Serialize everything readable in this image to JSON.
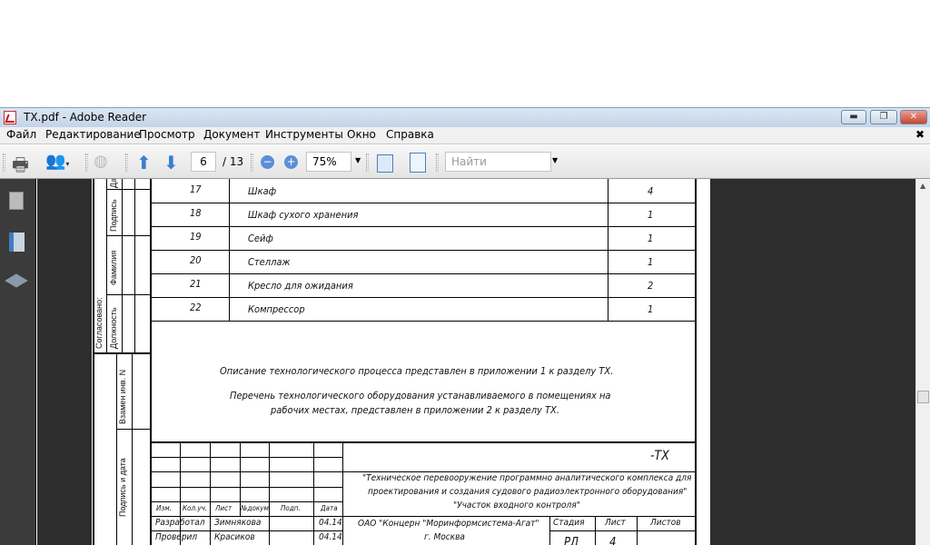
{
  "window": {
    "title": "TX.pdf - Adobe Reader"
  },
  "menu": [
    "Файл",
    "Редактирование",
    "Просмотр",
    "Документ",
    "Инструменты",
    "Окно",
    "Справка"
  ],
  "toolbar": {
    "page_current": "6",
    "page_total": "/ 13",
    "zoom": "75%",
    "search_placeholder": "Найти"
  },
  "stamps": {
    "date": "Дата",
    "signature": "Подпись",
    "surname": "Фамилия",
    "position": "Должность",
    "agreed": "Согласовано:",
    "replaced": "Взамен инв. N",
    "sign_date": "Подпись и дата"
  },
  "rows": [
    {
      "n": "17",
      "name": "Шкаф",
      "qty": "4"
    },
    {
      "n": "18",
      "name": "Шкаф сухого хранения",
      "qty": "1"
    },
    {
      "n": "19",
      "name": "Сейф",
      "qty": "1"
    },
    {
      "n": "20",
      "name": "Стеллаж",
      "qty": "1"
    },
    {
      "n": "21",
      "name": "Кресло для ожидания",
      "qty": "2"
    },
    {
      "n": "22",
      "name": "Компрессор",
      "qty": "1"
    }
  ],
  "notes": [
    "Описание технологического процесса представлен в приложении 1 к разделу ТХ.",
    "Перечень технологического оборудования устанавливаемого в помещениях на",
    "рабочих местах, представлен в приложении 2 к разделу ТХ."
  ],
  "titleblock": {
    "code": "-ТХ",
    "project_1": "\"Техническое перевооружение программно аналитического комплекса для",
    "project_2": "проектирования и создания судового радиоэлектронного оборудования\"",
    "project_3": "\"Участок входного контроля\"",
    "headers": [
      "Изм.",
      "Кол.уч.",
      "Лист",
      "№докум.",
      "Подп.",
      "Дата"
    ],
    "developed": "Разработал",
    "developer": "Зимнякова",
    "dev_date": "04.14",
    "checked": "Проверил",
    "checker": "Красиков",
    "chk_date": "04.14",
    "org": "ОАО \"Концерн \"Моринформсистема-Агат\"",
    "city": "г. Москва",
    "stage_h": "Стадия",
    "sheet_h": "Лист",
    "sheets_h": "Листов",
    "stage": "РД",
    "sheet": "4"
  }
}
